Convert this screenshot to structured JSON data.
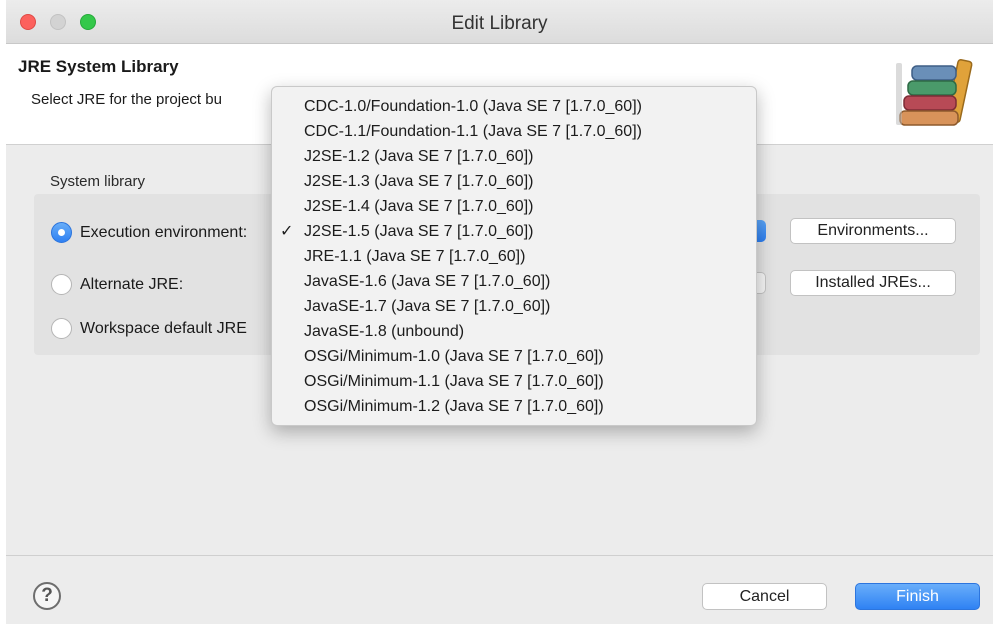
{
  "window": {
    "title": "Edit Library"
  },
  "header": {
    "title": "JRE System Library",
    "description": "Select JRE for the project bu",
    "icon": "library-books-icon"
  },
  "group": {
    "label": "System library",
    "options": [
      {
        "label": "Execution environment:",
        "selected": true
      },
      {
        "label": "Alternate JRE:",
        "selected": false
      },
      {
        "label": "Workspace default JRE",
        "selected": false
      }
    ],
    "environments_button": "Environments...",
    "installed_jres_button": "Installed JREs..."
  },
  "menu": {
    "items": [
      {
        "label": "CDC-1.0/Foundation-1.0 (Java SE 7 [1.7.0_60])",
        "check": ""
      },
      {
        "label": "CDC-1.1/Foundation-1.1 (Java SE 7 [1.7.0_60])",
        "check": ""
      },
      {
        "label": "J2SE-1.2 (Java SE 7 [1.7.0_60])",
        "check": ""
      },
      {
        "label": "J2SE-1.3 (Java SE 7 [1.7.0_60])",
        "check": ""
      },
      {
        "label": "J2SE-1.4 (Java SE 7 [1.7.0_60])",
        "check": ""
      },
      {
        "label": "J2SE-1.5 (Java SE 7 [1.7.0_60])",
        "check": "✓"
      },
      {
        "label": "JRE-1.1 (Java SE 7 [1.7.0_60])",
        "check": ""
      },
      {
        "label": "JavaSE-1.6 (Java SE 7 [1.7.0_60])",
        "check": ""
      },
      {
        "label": "JavaSE-1.7 (Java SE 7 [1.7.0_60])",
        "check": ""
      },
      {
        "label": "JavaSE-1.8 (unbound)",
        "check": ""
      },
      {
        "label": "OSGi/Minimum-1.0 (Java SE 7 [1.7.0_60])",
        "check": ""
      },
      {
        "label": "OSGi/Minimum-1.1 (Java SE 7 [1.7.0_60])",
        "check": ""
      },
      {
        "label": "OSGi/Minimum-1.2 (Java SE 7 [1.7.0_60])",
        "check": ""
      }
    ]
  },
  "footer": {
    "help_label": "?",
    "cancel": "Cancel",
    "finish": "Finish"
  },
  "colors": {
    "accent": "#2f82f3",
    "close": "#fc615d",
    "zoom": "#34c84a"
  }
}
